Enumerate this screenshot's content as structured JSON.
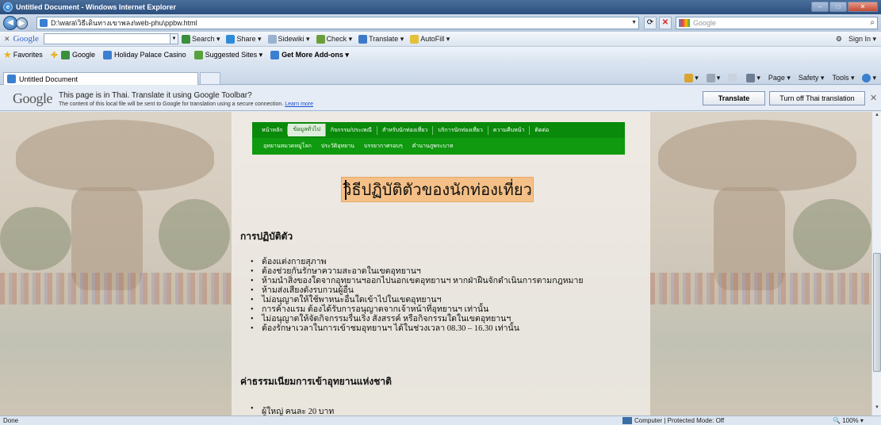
{
  "window": {
    "title": "Untitled Document - Windows Internet Explorer",
    "buttons": [
      "–",
      "□",
      "✕"
    ]
  },
  "address_bar": {
    "url": "D:\\wara\\วิธีเดินทางเขาพลง\\web-phu\\ppbw.html",
    "search_placeholder": "Google"
  },
  "google_toolbar": {
    "logo": "Google",
    "items": [
      "Search ▾",
      "Share ▾",
      "Sidewiki ▾",
      "Check ▾",
      "Translate ▾",
      "AutoFill ▾"
    ],
    "sign_in": "Sign In ▾"
  },
  "favorites_bar": {
    "label": "Favorites",
    "items": [
      "Google",
      "Holiday Palace Casino",
      "Suggested Sites ▾",
      "Get More Add-ons ▾"
    ]
  },
  "tab": {
    "title": "Untitled Document"
  },
  "command_bar": {
    "items": [
      "Page ▾",
      "Safety ▾",
      "Tools ▾"
    ]
  },
  "translate_bar": {
    "logo": "Google",
    "message": "This page is in Thai.  Translate it using Google Toolbar?",
    "submessage": "The content of this local file will be sent to Google for translation using a secure connection.",
    "learn_more": "Learn more",
    "translate_button": "Translate",
    "turn_off_button": "Turn off Thai translation",
    "close": "✕"
  },
  "site_nav": {
    "row1": [
      "หน้าหลัก",
      "ข้อมูลทั่วไป",
      "กิจกรรม/ประเพณี",
      "สำหรับนักท่องเที่ยว",
      "บริการนักท่องเที่ยว",
      "ความคืบหน้า",
      "ติดต่อ"
    ],
    "row1_active_index": 1,
    "row2": [
      "อุทยานหมวดหมู่โลก",
      "ประวัติอุทยาน",
      "บรรยากาศรอบๆ",
      "ตำนานภูพระบาท"
    ]
  },
  "page": {
    "heading": "วิธีปฏิบัติตัวของนักท่องเที่ยว",
    "section1_title": "การปฏิบัติตัว",
    "rules": [
      "ต้องแต่งกายสุภาพ",
      "ต้องช่วยกันรักษาความสะอาดในเขตอุทยานฯ",
      "ห้ามนำสิ่งของใดจากอุทยานฯออกไปนอกเขตอุทยานฯ หากฝ่าฝืนจักดำเนินการตามกฎหมาย",
      "ห้ามส่งเสียงดังรบกวนผู้อื่น",
      "ไม่อนุญาตให้ใช้พาหนะอื่นใดเข้าไปในเขตอุทยานฯ",
      "การค้างแรม ต้องได้รับการอนุญาตจากเจ้าหน้าที่อุทยานฯ เท่านั้น",
      "ไม่อนุญาตให้จัดกิจกรรมรื่นเริง สังสรรค์ หรือกิจกรรมใดในเขตอุทยานฯ",
      "ต้องรักษาเวลาในการเข้าชมอุทยานฯ ได้ในช่วงเวลา 08.30 – 16.30 เท่านั้น"
    ],
    "section2_title": "ค่าธรรมเนียมการเข้าอุทยานแห่งชาติ",
    "fees": [
      "ผู้ใหญ่ คนละ 20 บาท"
    ]
  },
  "status_bar": {
    "status": "Done",
    "zone": "Computer | Protected Mode: Off",
    "zoom": "100%"
  }
}
